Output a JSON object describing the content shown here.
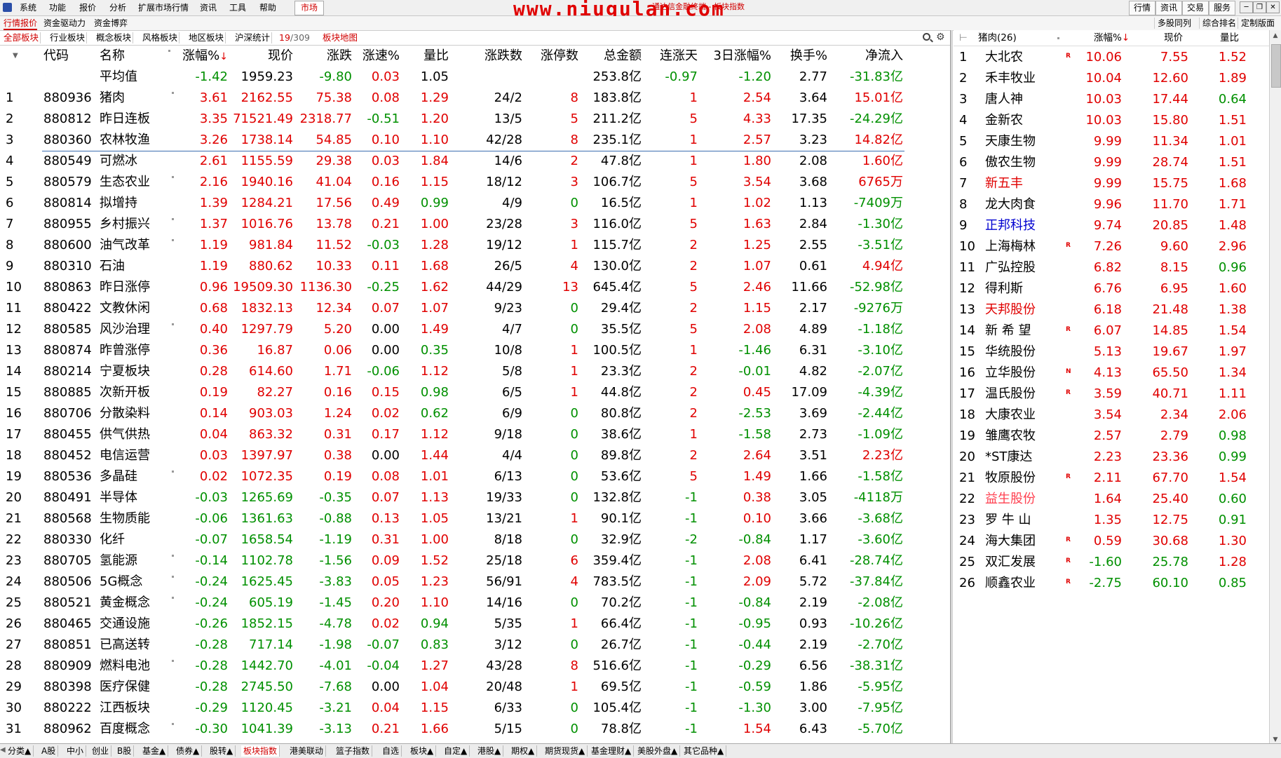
{
  "menu": {
    "items": [
      "系统",
      "功能",
      "报价",
      "分析",
      "扩展市场行情",
      "资讯",
      "工具",
      "帮助"
    ],
    "market": "市场",
    "watermark": "www.niugulan.com",
    "subtitle": "通达信金融终端 - 板块指数",
    "right_buttons": [
      "行情",
      "资讯",
      "交易",
      "服务"
    ],
    "window_buttons": [
      "─",
      "❐",
      "✕"
    ]
  },
  "tabs2": {
    "items": [
      "行情报价",
      "资金驱动力",
      "资金博弈"
    ],
    "right": [
      "多股同列",
      "综合排名",
      "定制版面"
    ]
  },
  "tabs3": {
    "items": [
      "全部板块",
      "行业板块",
      "概念板块",
      "风格板块",
      "地区板块",
      "沪深统计"
    ],
    "count_cur": "19",
    "count_total": "/309",
    "map": "板块地图"
  },
  "table": {
    "headers": [
      "代码",
      "名称",
      "涨幅%",
      "现价",
      "涨跌",
      "涨速%",
      "量比",
      "涨跌数",
      "涨停数",
      "总金额",
      "连涨天",
      "3日涨幅%",
      "换手%",
      "净流入"
    ],
    "sort_arrow": "↓",
    "avg": {
      "name": "平均值",
      "pct": "-1.42",
      "price": "1959.23",
      "chg": "-9.80",
      "speed": "0.03",
      "vr": "1.05",
      "amt": "253.8亿",
      "days": "-0.97",
      "d3": "-1.20",
      "turn": "2.77",
      "flow": "-31.83亿"
    },
    "rows": [
      [
        "1",
        "880936",
        "猪肉",
        "3.61",
        "2162.55",
        "75.38",
        "0.08",
        "1.29",
        "24/2",
        "8",
        "183.8亿",
        "1",
        "2.54",
        "3.64",
        "15.01亿",
        1
      ],
      [
        "2",
        "880812",
        "昨日连板",
        "3.35",
        "71521.49",
        "2318.77",
        "-0.51",
        "1.20",
        "13/5",
        "5",
        "211.2亿",
        "5",
        "4.33",
        "17.35",
        "-24.29亿",
        0
      ],
      [
        "3",
        "880360",
        "农林牧渔",
        "3.26",
        "1738.14",
        "54.85",
        "0.10",
        "1.10",
        "42/28",
        "8",
        "235.1亿",
        "1",
        "2.57",
        "3.23",
        "14.82亿",
        0
      ],
      [
        "4",
        "880549",
        "可燃冰",
        "2.61",
        "1155.59",
        "29.38",
        "0.03",
        "1.84",
        "14/6",
        "2",
        "47.8亿",
        "1",
        "1.80",
        "2.08",
        "1.60亿",
        0
      ],
      [
        "5",
        "880579",
        "生态农业",
        "2.16",
        "1940.16",
        "41.04",
        "0.16",
        "1.15",
        "18/12",
        "3",
        "106.7亿",
        "5",
        "3.54",
        "3.68",
        "6765万",
        1
      ],
      [
        "6",
        "880814",
        "拟增持",
        "1.39",
        "1284.21",
        "17.56",
        "0.49",
        "0.99",
        "4/9",
        "0",
        "16.5亿",
        "1",
        "1.02",
        "1.13",
        "-7409万",
        0
      ],
      [
        "7",
        "880955",
        "乡村振兴",
        "1.37",
        "1016.76",
        "13.78",
        "0.21",
        "1.00",
        "23/28",
        "3",
        "116.0亿",
        "5",
        "1.63",
        "2.84",
        "-1.30亿",
        1
      ],
      [
        "8",
        "880600",
        "油气改革",
        "1.19",
        "981.84",
        "11.52",
        "-0.03",
        "1.28",
        "19/12",
        "1",
        "115.7亿",
        "2",
        "1.25",
        "2.55",
        "-3.51亿",
        1
      ],
      [
        "9",
        "880310",
        "石油",
        "1.19",
        "880.62",
        "10.33",
        "0.11",
        "1.68",
        "26/5",
        "4",
        "130.0亿",
        "2",
        "1.07",
        "0.61",
        "4.94亿",
        0
      ],
      [
        "10",
        "880863",
        "昨日涨停",
        "0.96",
        "19509.30",
        "1136.30",
        "-0.25",
        "1.62",
        "44/29",
        "13",
        "645.4亿",
        "5",
        "2.46",
        "11.66",
        "-52.98亿",
        0
      ],
      [
        "11",
        "880422",
        "文教休闲",
        "0.68",
        "1832.13",
        "12.34",
        "0.07",
        "1.07",
        "9/23",
        "0",
        "29.4亿",
        "2",
        "1.15",
        "2.17",
        "-9276万",
        0
      ],
      [
        "12",
        "880585",
        "风沙治理",
        "0.40",
        "1297.79",
        "5.20",
        "0.00",
        "1.49",
        "4/7",
        "0",
        "35.5亿",
        "5",
        "2.08",
        "4.89",
        "-1.18亿",
        1
      ],
      [
        "13",
        "880874",
        "昨曾涨停",
        "0.36",
        "16.87",
        "0.06",
        "0.00",
        "0.35",
        "10/8",
        "1",
        "100.5亿",
        "1",
        "-1.46",
        "6.31",
        "-3.10亿",
        0
      ],
      [
        "14",
        "880214",
        "宁夏板块",
        "0.28",
        "614.60",
        "1.71",
        "-0.06",
        "1.12",
        "5/8",
        "1",
        "23.3亿",
        "2",
        "-0.01",
        "4.82",
        "-2.07亿",
        0
      ],
      [
        "15",
        "880885",
        "次新开板",
        "0.19",
        "82.27",
        "0.16",
        "0.15",
        "0.98",
        "6/5",
        "1",
        "44.8亿",
        "2",
        "0.45",
        "17.09",
        "-4.39亿",
        0
      ],
      [
        "16",
        "880706",
        "分散染料",
        "0.14",
        "903.03",
        "1.24",
        "0.02",
        "0.62",
        "6/9",
        "0",
        "80.8亿",
        "2",
        "-2.53",
        "3.69",
        "-2.44亿",
        0
      ],
      [
        "17",
        "880455",
        "供气供热",
        "0.04",
        "863.32",
        "0.31",
        "0.17",
        "1.12",
        "9/18",
        "0",
        "38.6亿",
        "1",
        "-1.58",
        "2.73",
        "-1.09亿",
        0
      ],
      [
        "18",
        "880452",
        "电信运营",
        "0.03",
        "1397.97",
        "0.38",
        "0.00",
        "1.44",
        "4/4",
        "0",
        "89.8亿",
        "2",
        "2.64",
        "3.51",
        "2.23亿",
        0
      ],
      [
        "19",
        "880536",
        "多晶硅",
        "0.02",
        "1072.35",
        "0.19",
        "0.08",
        "1.01",
        "6/13",
        "0",
        "53.6亿",
        "5",
        "1.49",
        "1.66",
        "-1.58亿",
        1
      ],
      [
        "20",
        "880491",
        "半导体",
        "-0.03",
        "1265.69",
        "-0.35",
        "0.07",
        "1.13",
        "19/33",
        "0",
        "132.8亿",
        "-1",
        "0.38",
        "3.05",
        "-4118万",
        0
      ],
      [
        "21",
        "880568",
        "生物质能",
        "-0.06",
        "1361.63",
        "-0.88",
        "0.13",
        "1.05",
        "13/21",
        "1",
        "90.1亿",
        "-1",
        "0.10",
        "3.66",
        "-3.68亿",
        0
      ],
      [
        "22",
        "880330",
        "化纤",
        "-0.07",
        "1658.54",
        "-1.19",
        "0.31",
        "1.00",
        "8/18",
        "0",
        "32.9亿",
        "-2",
        "-0.84",
        "1.17",
        "-3.60亿",
        0
      ],
      [
        "23",
        "880705",
        "氢能源",
        "-0.14",
        "1102.78",
        "-1.56",
        "0.09",
        "1.52",
        "25/18",
        "6",
        "359.4亿",
        "-1",
        "2.08",
        "6.41",
        "-28.74亿",
        1
      ],
      [
        "24",
        "880506",
        "5G概念",
        "-0.24",
        "1625.45",
        "-3.83",
        "0.05",
        "1.23",
        "56/91",
        "4",
        "783.5亿",
        "-1",
        "2.09",
        "5.72",
        "-37.84亿",
        1
      ],
      [
        "25",
        "880521",
        "黄金概念",
        "-0.24",
        "605.19",
        "-1.45",
        "0.20",
        "1.10",
        "14/16",
        "0",
        "70.2亿",
        "-1",
        "-0.84",
        "2.19",
        "-2.08亿",
        1
      ],
      [
        "26",
        "880465",
        "交通设施",
        "-0.26",
        "1852.15",
        "-4.78",
        "0.02",
        "0.94",
        "5/35",
        "1",
        "66.4亿",
        "-1",
        "-0.95",
        "0.93",
        "-10.26亿",
        0
      ],
      [
        "27",
        "880851",
        "已高送转",
        "-0.28",
        "717.14",
        "-1.98",
        "-0.07",
        "0.83",
        "3/12",
        "0",
        "26.7亿",
        "-1",
        "-0.44",
        "2.19",
        "-2.70亿",
        0
      ],
      [
        "28",
        "880909",
        "燃料电池",
        "-0.28",
        "1442.70",
        "-4.01",
        "-0.04",
        "1.27",
        "43/28",
        "8",
        "516.6亿",
        "-1",
        "-0.29",
        "6.56",
        "-38.31亿",
        1
      ],
      [
        "29",
        "880398",
        "医疗保健",
        "-0.28",
        "2745.50",
        "-7.68",
        "0.00",
        "1.04",
        "20/48",
        "1",
        "69.5亿",
        "-1",
        "-0.59",
        "1.86",
        "-5.95亿",
        0
      ],
      [
        "30",
        "880222",
        "江西板块",
        "-0.29",
        "1120.45",
        "-3.21",
        "0.04",
        "1.15",
        "6/33",
        "0",
        "105.4亿",
        "-1",
        "-1.30",
        "3.00",
        "-7.95亿",
        0
      ],
      [
        "31",
        "880962",
        "百度概念",
        "-0.30",
        "1041.39",
        "-3.13",
        "0.21",
        "1.66",
        "5/15",
        "0",
        "78.8亿",
        "-1",
        "1.54",
        "6.43",
        "-5.70亿",
        1
      ]
    ]
  },
  "right": {
    "title": "猪肉(26)",
    "headers": [
      "涨幅%",
      "现价",
      "量比"
    ],
    "sort_arrow": "↓",
    "rows": [
      [
        "1",
        "大北农",
        "R",
        "10.06",
        "7.55",
        "1.52",
        "blk"
      ],
      [
        "2",
        "禾丰牧业",
        "",
        "10.04",
        "12.60",
        "1.89",
        "blk"
      ],
      [
        "3",
        "唐人神",
        "",
        "10.03",
        "17.44",
        "0.64",
        "blk"
      ],
      [
        "4",
        "金新农",
        "",
        "10.03",
        "15.80",
        "1.51",
        "blk"
      ],
      [
        "5",
        "天康生物",
        "",
        "9.99",
        "11.34",
        "1.01",
        "blk"
      ],
      [
        "6",
        "傲农生物",
        "",
        "9.99",
        "28.74",
        "1.51",
        "blk"
      ],
      [
        "7",
        "新五丰",
        "",
        "9.99",
        "15.75",
        "1.68",
        "up"
      ],
      [
        "8",
        "龙大肉食",
        "",
        "9.96",
        "11.70",
        "1.71",
        "blk"
      ],
      [
        "9",
        "正邦科技",
        "",
        "9.74",
        "20.85",
        "1.48",
        "blue"
      ],
      [
        "10",
        "上海梅林",
        "R",
        "7.26",
        "9.60",
        "2.96",
        "blk"
      ],
      [
        "11",
        "广弘控股",
        "",
        "6.82",
        "8.15",
        "0.96",
        "blk"
      ],
      [
        "12",
        "得利斯",
        "",
        "6.76",
        "6.95",
        "1.60",
        "blk"
      ],
      [
        "13",
        "天邦股份",
        "",
        "6.18",
        "21.48",
        "1.38",
        "up"
      ],
      [
        "14",
        "新 希 望",
        "R",
        "6.07",
        "14.85",
        "1.54",
        "blk"
      ],
      [
        "15",
        "华统股份",
        "",
        "5.13",
        "19.67",
        "1.97",
        "blk"
      ],
      [
        "16",
        "立华股份",
        "N",
        "4.13",
        "65.50",
        "1.34",
        "blk"
      ],
      [
        "17",
        "温氏股份",
        "R",
        "3.59",
        "40.71",
        "1.11",
        "blk"
      ],
      [
        "18",
        "大康农业",
        "",
        "3.54",
        "2.34",
        "2.06",
        "blk"
      ],
      [
        "19",
        "雏鹰农牧",
        "",
        "2.57",
        "2.79",
        "0.98",
        "blk"
      ],
      [
        "20",
        "*ST康达",
        "",
        "2.23",
        "23.36",
        "0.99",
        "blk"
      ],
      [
        "21",
        "牧原股份",
        "R",
        "2.11",
        "67.70",
        "1.54",
        "blk"
      ],
      [
        "22",
        "益生股份",
        "",
        "1.64",
        "25.40",
        "0.60",
        "pink"
      ],
      [
        "23",
        "罗 牛 山",
        "",
        "1.35",
        "12.75",
        "0.91",
        "blk"
      ],
      [
        "24",
        "海大集团",
        "R",
        "0.59",
        "30.68",
        "1.30",
        "blk"
      ],
      [
        "25",
        "双汇发展",
        "R",
        "-1.60",
        "25.78",
        "1.28",
        "blk"
      ],
      [
        "26",
        "顺鑫农业",
        "R",
        "-2.75",
        "60.10",
        "0.85",
        "blk"
      ]
    ]
  },
  "bottom_tabs": [
    "分类▲",
    "A股",
    "中小",
    "创业",
    "B股",
    "基金▲",
    "债券▲",
    "股转▲",
    "板块指数",
    "港美联动",
    "篮子指数",
    "自选",
    "板块▲",
    "自定▲",
    "港股▲",
    "期权▲",
    "期货现货▲",
    "基金理财▲",
    "美股外盘▲",
    "其它品种▲"
  ],
  "bottom_active": "板块指数"
}
